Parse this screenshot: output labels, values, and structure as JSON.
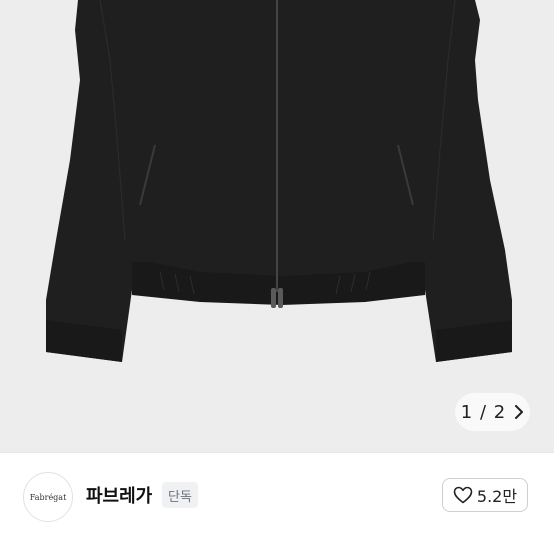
{
  "gallery": {
    "image_subject": "black zip-up blouson jacket",
    "page_current": "1",
    "page_separator": "/",
    "page_total": "2",
    "page_text": "1 / 2"
  },
  "brand": {
    "logo_text": "Fabrégat",
    "name": "파브레가",
    "badge": "단독"
  },
  "like": {
    "count": "5.2만"
  },
  "colors": {
    "background": "#ededed",
    "jacket": "#1e1e1e",
    "button_border": "#cfcfcf"
  }
}
